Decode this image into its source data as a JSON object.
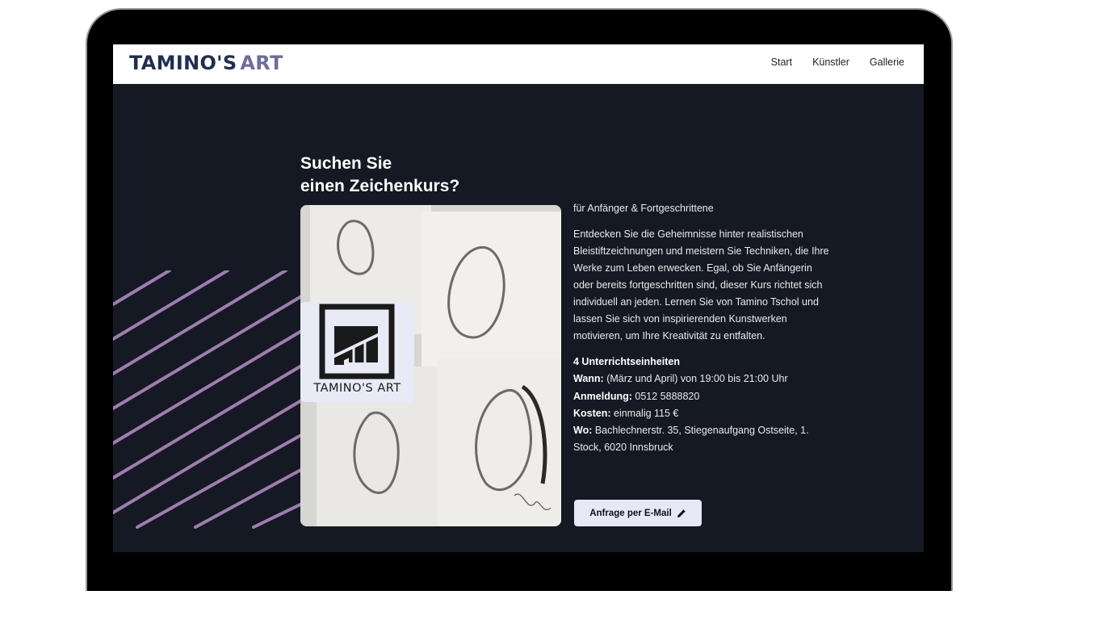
{
  "brand": {
    "name_part1": "TAMINO'S",
    "name_part2": "ART"
  },
  "nav": {
    "items": [
      "Start",
      "Künstler",
      "Gallerie"
    ]
  },
  "hero": {
    "heading_line1": "Suchen Sie",
    "heading_line2": "einen Zeichenkurs?",
    "subtitle": "für Anfänger & Fortgeschrittene",
    "description": "Entdecken Sie die Geheimnisse hinter realistischen Bleistiftzeichnungen und meistern Sie Techniken, die Ihre Werke zum Leben erwecken. Egal, ob Sie Anfängerin oder bereits fortgeschritten sind, dieser Kurs richtet sich individuell an jeden. Lernen Sie von Tamino Tschol und lassen Sie sich von inspirierenden Kunstwerken motivieren, um Ihre Kreativität zu entfalten.",
    "image_logo_text": "TAMINO'S ART"
  },
  "details": {
    "units": "4 Unterrichtseinheiten",
    "when_label": "Wann:",
    "when_value": " (März und April) von 19:00 bis 21:00 Uhr",
    "register_label": "Anmeldung:",
    "register_value": " 0512 5888820",
    "cost_label": "Kosten:",
    "cost_value": " einmalig 115 €",
    "where_label": "Wo:",
    "where_value": " Bachlechnerstr. 35, Stiegenaufgang Ostseite, 1. Stock, 6020 Innsbruck"
  },
  "cta": {
    "label": "Anfrage per E-Mail"
  },
  "colors": {
    "page_bg": "#141923",
    "brand_primary": "#1f2f52",
    "brand_secondary": "#6b6f9c",
    "stripe": "#a07cb0",
    "button_bg": "#e6e8f7"
  },
  "icons": [
    "pencil-icon",
    "tamino-logo-icon"
  ]
}
